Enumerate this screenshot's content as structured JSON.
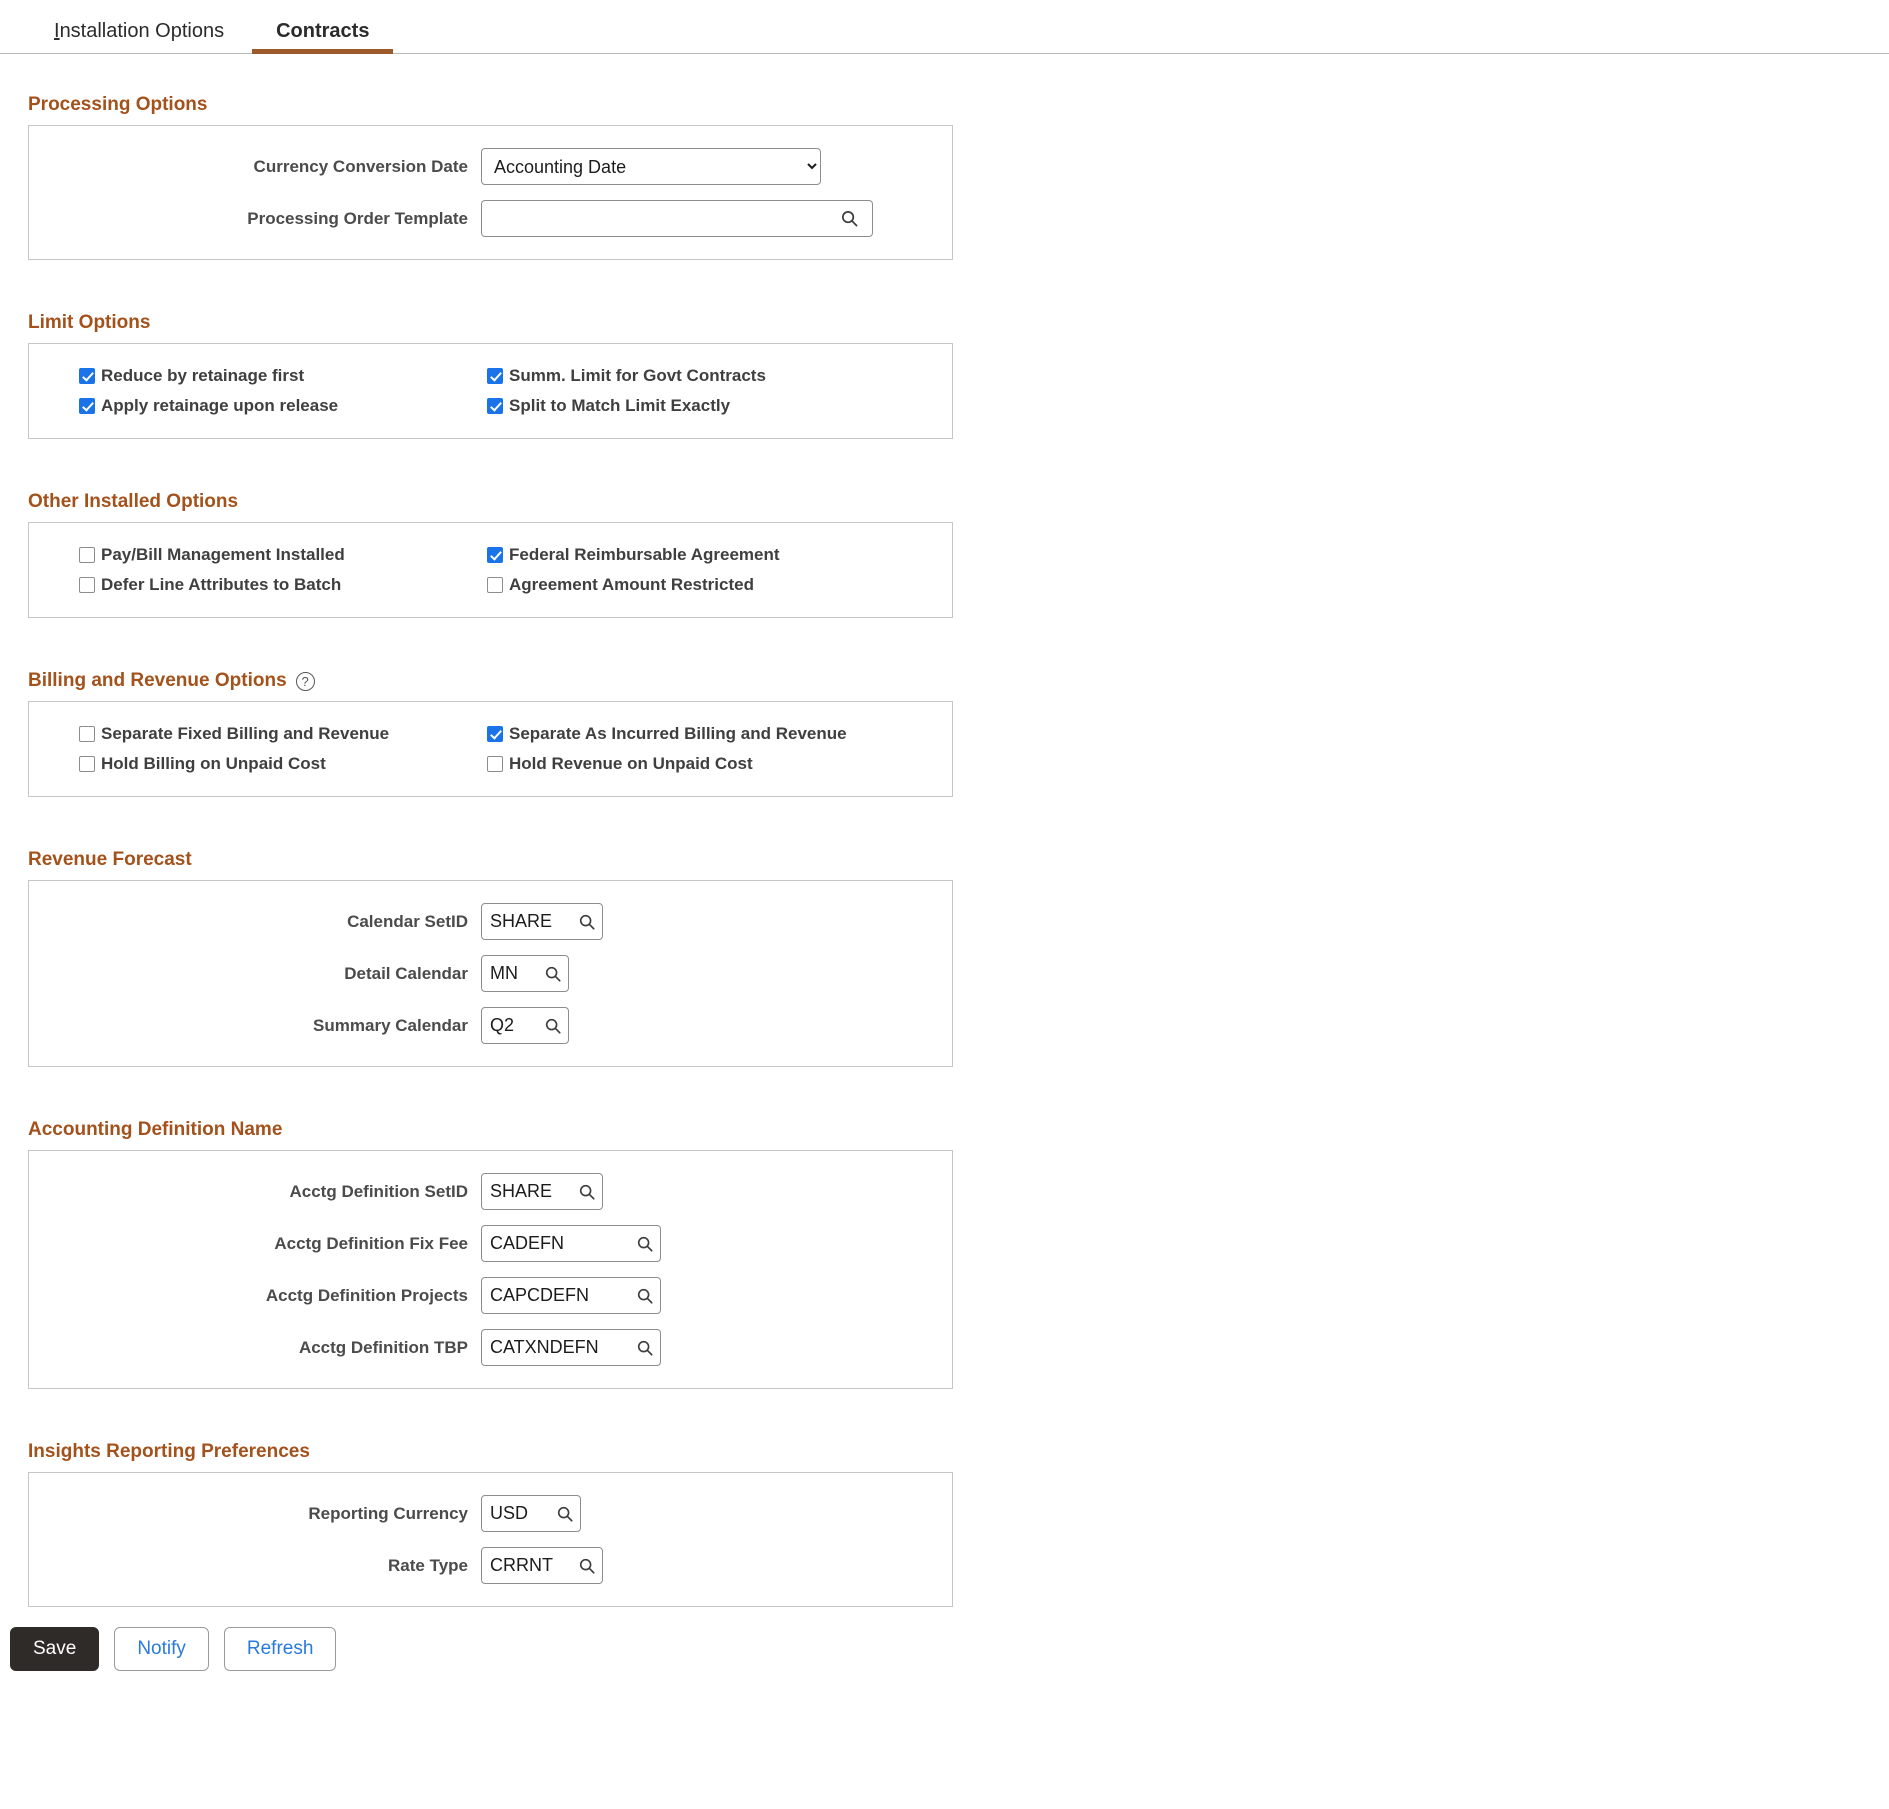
{
  "tabs": [
    {
      "name": "installation-options",
      "label": "Installation Options",
      "mnemonic": "I",
      "rest": "nstallation Options",
      "active": false
    },
    {
      "name": "contracts",
      "label": "Contracts",
      "active": true
    }
  ],
  "sections": {
    "processing_options": {
      "title": "Processing Options",
      "fields": {
        "currency_conversion_date": {
          "label": "Currency Conversion Date",
          "value": "Accounting Date",
          "options": [
            "Accounting Date"
          ]
        },
        "processing_order_template": {
          "label": "Processing Order Template",
          "value": "",
          "placeholder": "",
          "icon": "search-icon"
        }
      }
    },
    "limit_options": {
      "title": "Limit Options",
      "checkboxes": [
        {
          "label": "Reduce by retainage first",
          "checked": true
        },
        {
          "label": "Summ. Limit for Govt Contracts",
          "checked": true
        },
        {
          "label": "Apply retainage upon release",
          "checked": true
        },
        {
          "label": "Split to Match Limit Exactly",
          "checked": true
        }
      ]
    },
    "other_installed_options": {
      "title": "Other Installed Options",
      "checkboxes": [
        {
          "label": "Pay/Bill Management Installed",
          "checked": false
        },
        {
          "label": "Federal Reimbursable Agreement",
          "checked": true
        },
        {
          "label": "Defer Line Attributes to Batch",
          "checked": false
        },
        {
          "label": "Agreement Amount Restricted",
          "checked": false
        }
      ]
    },
    "billing_and_revenue_options": {
      "title": "Billing and Revenue Options",
      "help_icon": "?",
      "checkboxes": [
        {
          "label": "Separate Fixed Billing and Revenue",
          "checked": false
        },
        {
          "label": "Separate As Incurred Billing and Revenue",
          "checked": true
        },
        {
          "label": "Hold Billing on Unpaid Cost",
          "checked": false
        },
        {
          "label": "Hold Revenue on Unpaid Cost",
          "checked": false
        }
      ]
    },
    "revenue_forecast": {
      "title": "Revenue Forecast",
      "fields": {
        "calendar_setid": {
          "label": "Calendar SetID",
          "value": "SHARE",
          "icon": "search-icon"
        },
        "detail_calendar": {
          "label": "Detail Calendar",
          "value": "MN",
          "icon": "search-icon"
        },
        "summary_calendar": {
          "label": "Summary Calendar",
          "value": "Q2",
          "icon": "search-icon"
        }
      }
    },
    "accounting_definition_name": {
      "title": "Accounting Definition Name",
      "fields": {
        "acctg_definition_setid": {
          "label": "Acctg Definition SetID",
          "value": "SHARE",
          "icon": "search-icon"
        },
        "acctg_definition_fix_fee": {
          "label": "Acctg Definition Fix Fee",
          "value": "CADEFN",
          "icon": "search-icon"
        },
        "acctg_definition_projects": {
          "label": "Acctg Definition Projects",
          "value": "CAPCDEFN",
          "icon": "search-icon"
        },
        "acctg_definition_tbp": {
          "label": "Acctg Definition TBP",
          "value": "CATXNDEFN",
          "icon": "search-icon"
        }
      }
    },
    "insights_reporting_preferences": {
      "title": "Insights Reporting Preferences",
      "fields": {
        "reporting_currency": {
          "label": "Reporting Currency",
          "value": "USD",
          "icon": "search-icon"
        },
        "rate_type": {
          "label": "Rate Type",
          "value": "CRRNT",
          "icon": "search-icon"
        }
      }
    }
  },
  "buttons": {
    "save": "Save",
    "notify": "Notify",
    "refresh": "Refresh"
  },
  "colors": {
    "section_heading": "#a3521c",
    "tab_underline": "#9c5a2b",
    "checkbox_checked": "#1a73e8",
    "link_text": "#2a7ade",
    "save_bg": "#2f2b28"
  }
}
